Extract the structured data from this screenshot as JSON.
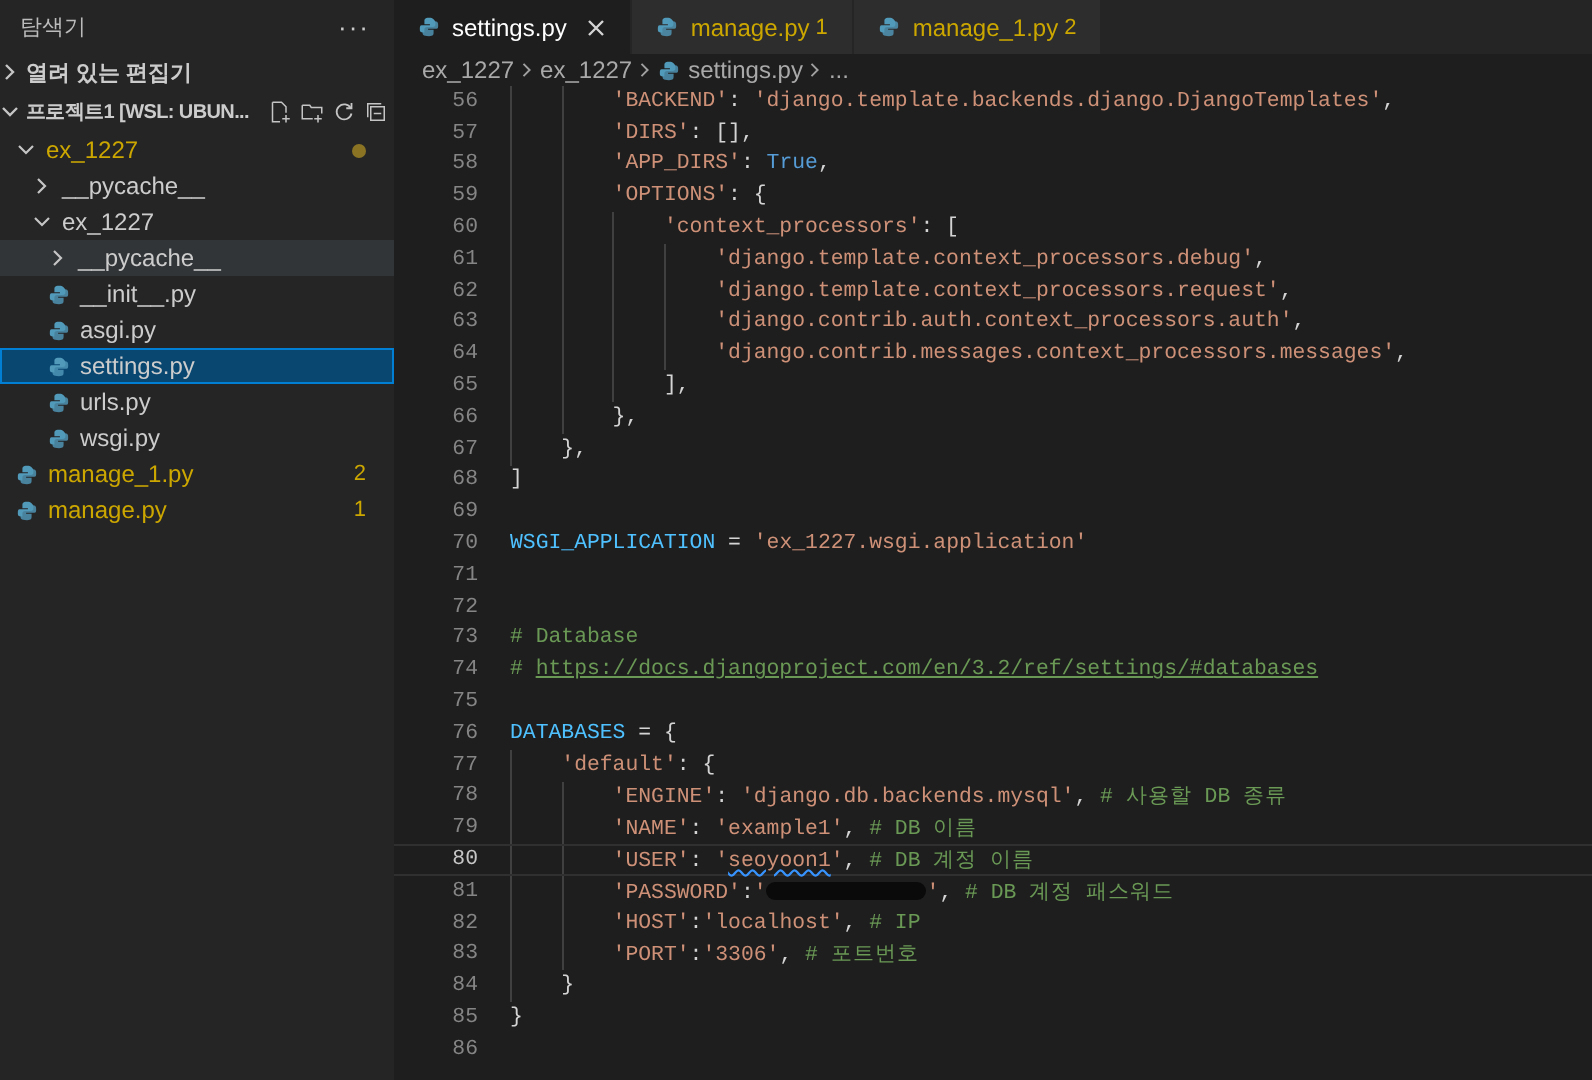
{
  "sidebar": {
    "title": "탐색기",
    "more": "···",
    "open_editors": {
      "label": "열려 있는 편집기",
      "expanded": false
    },
    "project": {
      "label": "프로젝트1 [WSL: UBUN...",
      "expanded": true,
      "items": [
        {
          "kind": "folder",
          "name": "ex_1227",
          "expanded": true,
          "modified": true,
          "dot": true,
          "selected": false,
          "hovered": false,
          "children": [
            {
              "kind": "folder",
              "name": "__pycache__",
              "expanded": false,
              "modified": false,
              "selected": false,
              "hovered": false
            },
            {
              "kind": "folder",
              "name": "ex_1227",
              "expanded": true,
              "modified": false,
              "selected": false,
              "hovered": false,
              "children": [
                {
                  "kind": "folder",
                  "name": "__pycache__",
                  "expanded": false,
                  "modified": false,
                  "selected": false,
                  "hovered": true
                },
                {
                  "kind": "file",
                  "name": "__init__.py",
                  "modified": false,
                  "selected": false,
                  "hovered": false
                },
                {
                  "kind": "file",
                  "name": "asgi.py",
                  "modified": false,
                  "selected": false,
                  "hovered": false
                },
                {
                  "kind": "file",
                  "name": "settings.py",
                  "modified": false,
                  "selected": true,
                  "hovered": false
                },
                {
                  "kind": "file",
                  "name": "urls.py",
                  "modified": false,
                  "selected": false,
                  "hovered": false
                },
                {
                  "kind": "file",
                  "name": "wsgi.py",
                  "modified": false,
                  "selected": false,
                  "hovered": false
                }
              ]
            }
          ]
        },
        {
          "kind": "file",
          "name": "manage_1.py",
          "modified": true,
          "badge": "2",
          "selected": false,
          "hovered": false
        },
        {
          "kind": "file",
          "name": "manage.py",
          "modified": true,
          "badge": "1",
          "selected": false,
          "hovered": false
        }
      ]
    }
  },
  "tabs": [
    {
      "label": "settings.py",
      "selected": true,
      "modified": false
    },
    {
      "label": "manage.py",
      "badge": "1",
      "selected": false,
      "modified": true
    },
    {
      "label": "manage_1.py",
      "badge": "2",
      "selected": false,
      "modified": true
    }
  ],
  "breadcrumb": [
    "ex_1227",
    "ex_1227",
    "settings.py",
    "..."
  ],
  "editor": {
    "lines": [
      {
        "number": "56",
        "current": false,
        "tokens": [
          {
            "kind": "str",
            "text": "        'BACKEND'"
          },
          {
            "kind": "plain",
            "text": ": "
          },
          {
            "kind": "str",
            "text": "'django.template.backends.django.DjangoTemplates'"
          },
          {
            "kind": "plain",
            "text": ","
          }
        ]
      },
      {
        "number": "57",
        "current": false,
        "tokens": [
          {
            "kind": "str",
            "text": "        'DIRS'"
          },
          {
            "kind": "plain",
            "text": ": [],"
          }
        ]
      },
      {
        "number": "58",
        "current": false,
        "tokens": [
          {
            "kind": "str",
            "text": "        'APP_DIRS'"
          },
          {
            "kind": "plain",
            "text": ": "
          },
          {
            "kind": "kw",
            "text": "True"
          },
          {
            "kind": "plain",
            "text": ","
          }
        ]
      },
      {
        "number": "59",
        "current": false,
        "tokens": [
          {
            "kind": "str",
            "text": "        'OPTIONS'"
          },
          {
            "kind": "plain",
            "text": ": {"
          }
        ]
      },
      {
        "number": "60",
        "current": false,
        "tokens": [
          {
            "kind": "str",
            "text": "            'context_processors'"
          },
          {
            "kind": "plain",
            "text": ": ["
          }
        ]
      },
      {
        "number": "61",
        "current": false,
        "tokens": [
          {
            "kind": "str",
            "text": "                'django.template.context_processors.debug'"
          },
          {
            "kind": "plain",
            "text": ","
          }
        ]
      },
      {
        "number": "62",
        "current": false,
        "tokens": [
          {
            "kind": "str",
            "text": "                'django.template.context_processors.request'"
          },
          {
            "kind": "plain",
            "text": ","
          }
        ]
      },
      {
        "number": "63",
        "current": false,
        "tokens": [
          {
            "kind": "str",
            "text": "                'django.contrib.auth.context_processors.auth'"
          },
          {
            "kind": "plain",
            "text": ","
          }
        ]
      },
      {
        "number": "64",
        "current": false,
        "tokens": [
          {
            "kind": "str",
            "text": "                'django.contrib.messages.context_processors.messages'"
          },
          {
            "kind": "plain",
            "text": ","
          }
        ]
      },
      {
        "number": "65",
        "current": false,
        "tokens": [
          {
            "kind": "plain",
            "text": "            ],"
          }
        ]
      },
      {
        "number": "66",
        "current": false,
        "tokens": [
          {
            "kind": "plain",
            "text": "        },"
          }
        ]
      },
      {
        "number": "67",
        "current": false,
        "tokens": [
          {
            "kind": "plain",
            "text": "    },"
          }
        ]
      },
      {
        "number": "68",
        "current": false,
        "tokens": [
          {
            "kind": "plain",
            "text": "]"
          }
        ]
      },
      {
        "number": "69",
        "current": false
      },
      {
        "number": "70",
        "current": false,
        "tokens": [
          {
            "kind": "var",
            "text": "WSGI_APPLICATION"
          },
          {
            "kind": "plain",
            "text": " = "
          },
          {
            "kind": "str",
            "text": "'ex_1227.wsgi.application'"
          }
        ]
      },
      {
        "number": "71",
        "current": false
      },
      {
        "number": "72",
        "current": false
      },
      {
        "number": "73",
        "current": false,
        "tokens": [
          {
            "kind": "comment",
            "text": "# Database"
          }
        ]
      },
      {
        "number": "74",
        "current": false,
        "tokens": [
          {
            "kind": "comment",
            "text": "# "
          },
          {
            "kind": "link",
            "text": "https://docs.djangoproject.com/en/3.2/ref/settings/#databases"
          }
        ]
      },
      {
        "number": "75",
        "current": false
      },
      {
        "number": "76",
        "current": false,
        "tokens": [
          {
            "kind": "var",
            "text": "DATABASES"
          },
          {
            "kind": "plain",
            "text": " = {"
          }
        ]
      },
      {
        "number": "77",
        "current": false,
        "tokens": [
          {
            "kind": "str",
            "text": "    'default'"
          },
          {
            "kind": "plain",
            "text": ": {"
          }
        ]
      },
      {
        "number": "78",
        "current": false,
        "tokens": [
          {
            "kind": "str",
            "text": "        'ENGINE'"
          },
          {
            "kind": "plain",
            "text": ": "
          },
          {
            "kind": "str",
            "text": "'django.db.backends.mysql'"
          },
          {
            "kind": "plain",
            "text": ", "
          },
          {
            "kind": "comment",
            "text": "# 사용할 DB 종류"
          }
        ]
      },
      {
        "number": "79",
        "current": false,
        "tokens": [
          {
            "kind": "str",
            "text": "        'NAME'"
          },
          {
            "kind": "plain",
            "text": ": "
          },
          {
            "kind": "str",
            "text": "'example1'"
          },
          {
            "kind": "plain",
            "text": ", "
          },
          {
            "kind": "comment",
            "text": "# DB 이름"
          }
        ]
      },
      {
        "number": "80",
        "current": true,
        "tokens": [
          {
            "kind": "str",
            "text": "        'USER'"
          },
          {
            "kind": "plain",
            "text": ": "
          },
          {
            "kind": "str",
            "text": "'"
          },
          {
            "kind": "str",
            "text": "seoyoon1",
            "squiggle": true
          },
          {
            "kind": "str",
            "text": "'"
          },
          {
            "kind": "plain",
            "text": ", "
          },
          {
            "kind": "comment",
            "text": "# DB 계정 이름"
          }
        ]
      },
      {
        "number": "81",
        "current": false,
        "tokens": [
          {
            "kind": "str",
            "text": "        'PASSWORD'"
          },
          {
            "kind": "plain",
            "text": ":"
          },
          {
            "kind": "str",
            "text": "'"
          },
          {
            "kind": "redacted"
          },
          {
            "kind": "str",
            "text": "'"
          },
          {
            "kind": "plain",
            "text": ", "
          },
          {
            "kind": "comment",
            "text": "# DB 계정 패스워드"
          }
        ]
      },
      {
        "number": "82",
        "current": false,
        "tokens": [
          {
            "kind": "str",
            "text": "        'HOST'"
          },
          {
            "kind": "plain",
            "text": ":"
          },
          {
            "kind": "str",
            "text": "'localhost'"
          },
          {
            "kind": "plain",
            "text": ", "
          },
          {
            "kind": "comment",
            "text": "# IP"
          }
        ]
      },
      {
        "number": "83",
        "current": false,
        "tokens": [
          {
            "kind": "str",
            "text": "        'PORT'"
          },
          {
            "kind": "plain",
            "text": ":"
          },
          {
            "kind": "str",
            "text": "'3306'"
          },
          {
            "kind": "plain",
            "text": ", "
          },
          {
            "kind": "comment",
            "text": "# 포트번호"
          }
        ]
      },
      {
        "number": "84",
        "current": false,
        "tokens": [
          {
            "kind": "plain",
            "text": "    }"
          }
        ]
      },
      {
        "number": "85",
        "current": false,
        "tokens": [
          {
            "kind": "plain",
            "text": "}"
          }
        ]
      },
      {
        "number": "86",
        "current": false
      }
    ]
  }
}
